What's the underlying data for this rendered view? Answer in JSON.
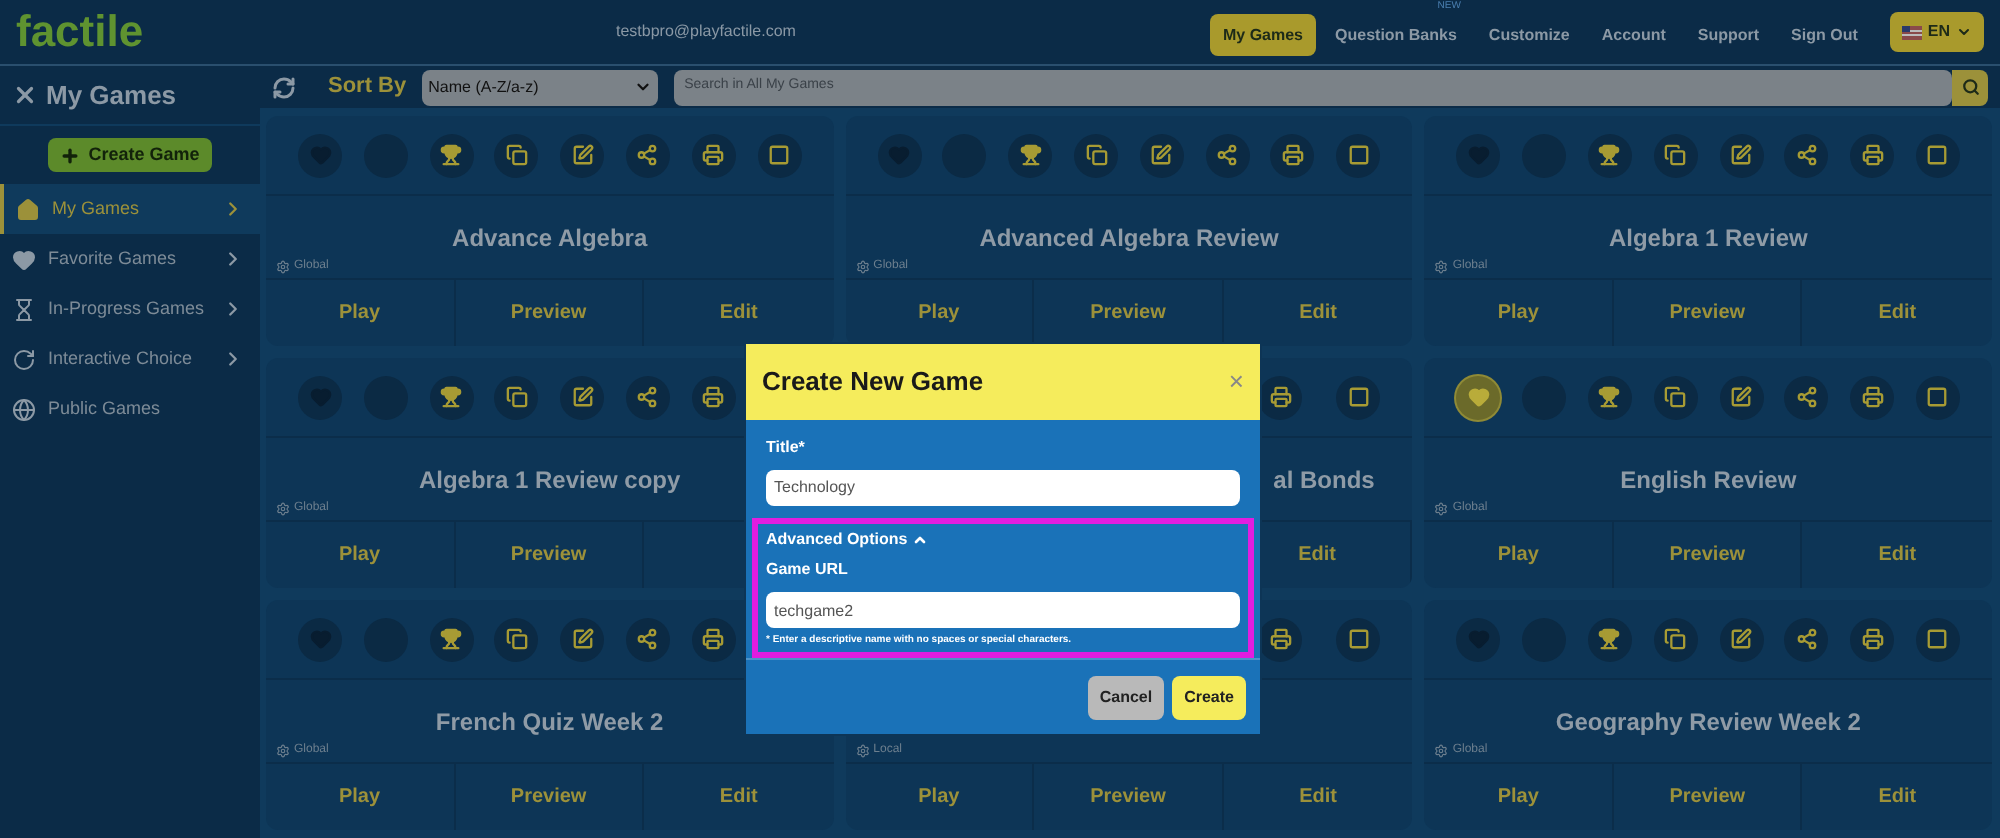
{
  "header": {
    "logo": "factile",
    "email": "testbpro@playfactile.com",
    "nav": [
      {
        "label": "My Games",
        "selected": true
      },
      {
        "label": "Question Banks",
        "selected": false,
        "badge": "NEW"
      },
      {
        "label": "Customize",
        "selected": false
      },
      {
        "label": "Account",
        "selected": false
      },
      {
        "label": "Support",
        "selected": false
      },
      {
        "label": "Sign Out",
        "selected": false
      }
    ],
    "language": "EN"
  },
  "sidebar": {
    "title": "My Games",
    "create_button": "Create Game",
    "items": [
      {
        "label": "My Games",
        "selected": true,
        "chevron": true
      },
      {
        "label": "Favorite Games",
        "selected": false,
        "chevron": true
      },
      {
        "label": "In-Progress Games",
        "selected": false,
        "chevron": true
      },
      {
        "label": "Interactive Choice",
        "selected": false,
        "chevron": true
      },
      {
        "label": "Public Games",
        "selected": false,
        "chevron": false
      }
    ]
  },
  "toolbar": {
    "sort_label": "Sort By",
    "sort_value": "Name (A-Z/a-z)",
    "search_placeholder": "Search in All My Games"
  },
  "cards": [
    {
      "kind": "full",
      "title": "Advance Algebra",
      "scope": "Global",
      "favorite": false,
      "buttons": [
        "Play",
        "Preview",
        "Edit"
      ]
    },
    {
      "kind": "full",
      "title": "Advanced Algebra Review",
      "scope": "Global",
      "favorite": false,
      "buttons": [
        "Play",
        "Preview",
        "Edit"
      ]
    },
    {
      "kind": "full",
      "title": "Algebra 1 Review",
      "scope": "Global",
      "favorite": false,
      "buttons": [
        "Play",
        "Preview",
        "Edit"
      ]
    },
    {
      "kind": "cut",
      "title": "Algebra 1 Review copy",
      "scope": "Global",
      "favorite": false,
      "buttons": [
        "Play",
        "Preview"
      ]
    },
    {
      "kind": "covered",
      "title": "al Bonds",
      "buttons": [
        "Edit"
      ]
    },
    {
      "kind": "full",
      "title": "English Review",
      "scope": "Global",
      "favorite": true,
      "buttons": [
        "Play",
        "Preview",
        "Edit"
      ]
    },
    {
      "kind": "cut",
      "title": "French Quiz Week 2",
      "scope": "Global",
      "favorite": false,
      "buttons": [
        "Play",
        "Preview",
        "Edit"
      ]
    },
    {
      "kind": "covered",
      "scope": "Local",
      "buttons": [
        "Play",
        "Preview",
        "Edit"
      ]
    },
    {
      "kind": "full",
      "title": "Geography Review Week 2",
      "scope": "Global",
      "favorite": false,
      "buttons": [
        "Play",
        "Preview",
        "Edit"
      ]
    }
  ],
  "dialog": {
    "title": "Create New Game",
    "close": "×",
    "title_label": "Title*",
    "title_value": "Technology",
    "advanced_label": "Advanced Options",
    "advanced_expanded": true,
    "url_label": "Game URL",
    "url_value": "techgame2",
    "hint": "* Enter a descriptive name with no spaces or special characters.",
    "buttons": [
      {
        "label": "Cancel",
        "kind": "secondary"
      },
      {
        "label": "Create",
        "kind": "primary"
      }
    ]
  }
}
